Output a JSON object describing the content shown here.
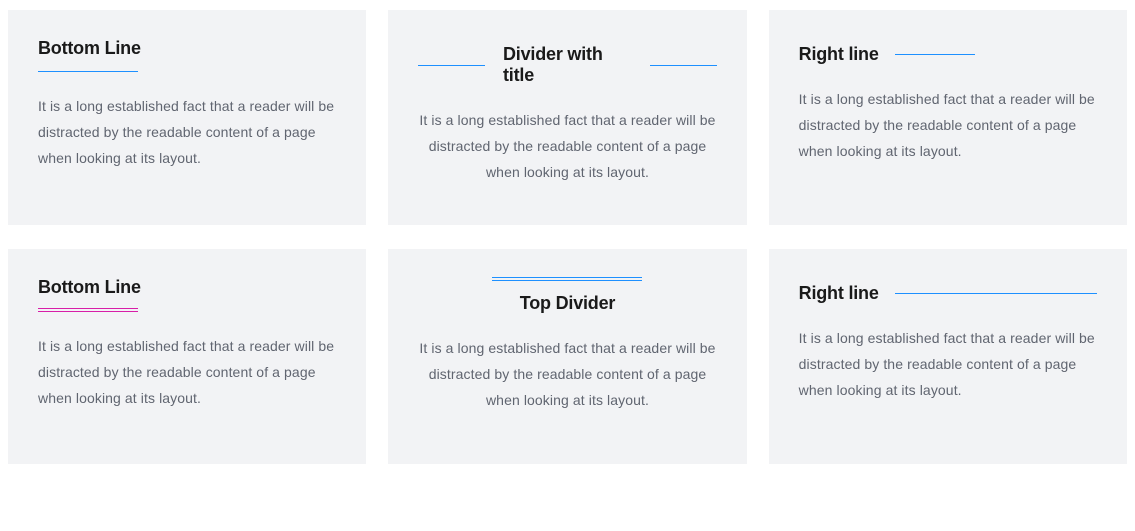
{
  "cards": [
    {
      "title": "Bottom Line",
      "body": "It is a long established fact that a reader will be distracted by the readable content of a page when looking at its layout."
    },
    {
      "title": "Divider with title",
      "body": "It is a long established fact that a reader will be distracted by the readable content of a page when looking at its layout."
    },
    {
      "title": "Right line",
      "body": "It is a long established fact that a reader will be distracted by the readable content of a page when looking at its layout."
    },
    {
      "title": "Bottom Line",
      "body": "It is a long established fact that a reader will be distracted by the readable content of a page when looking at its layout."
    },
    {
      "title": "Top Divider",
      "body": "It is a long established fact that a reader will be distracted by the readable content of a page when looking at its layout."
    },
    {
      "title": "Right line",
      "body": "It is a long established fact that a reader will be distracted by the readable content of a page when looking at its layout."
    }
  ],
  "colors": {
    "accent_blue": "#1e90ff",
    "accent_magenta": "#d81ea8",
    "card_bg": "#f2f3f5",
    "body_text": "#606570"
  }
}
